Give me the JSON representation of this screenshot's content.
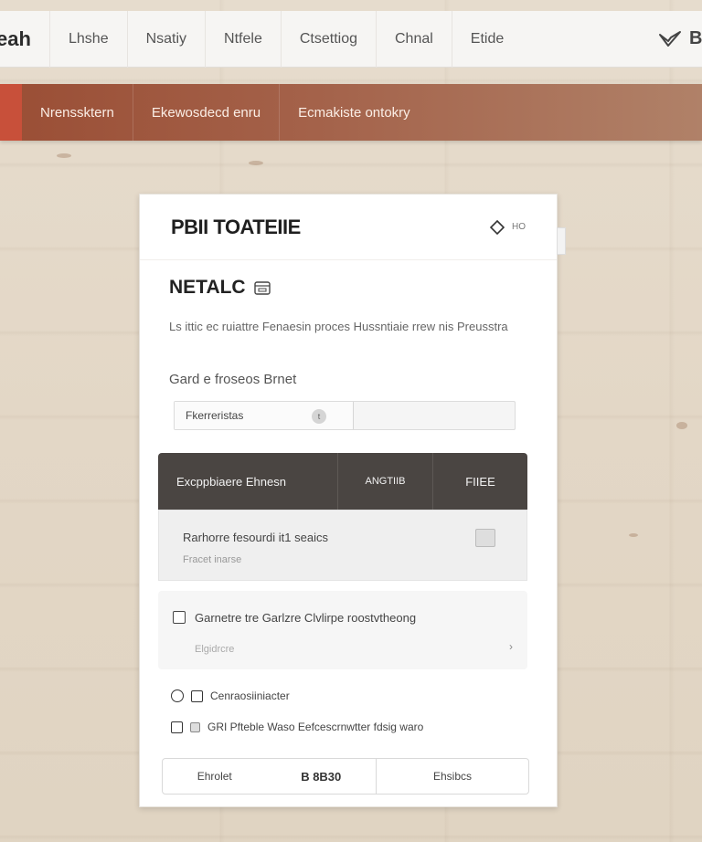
{
  "topnav": {
    "brand": "eah",
    "tabs": [
      "Lhshe",
      "Nsatiy",
      "Ntfele",
      "Ctsettiog",
      "Chnal",
      "Etide"
    ],
    "right_logo_text": "Bl"
  },
  "subnav": {
    "items": [
      "Nrenssktern",
      "Ekewosdecd enru",
      "Ecmakiste ontokry"
    ]
  },
  "card": {
    "header_title": "PBII TOATEIIE",
    "header_tool": "HO",
    "section_title": "NETALC",
    "description": "Ls ittic ec ruiattre Fenaesin proces Hussntiaie rrew nis Preusstra",
    "field_label": "Gard e froseos Brnet",
    "combo_value": "Fkerreristas",
    "combo_badge": "t",
    "table": {
      "col1": "Excppbiaere Ehnesn",
      "col2": "ANGTIIB",
      "col3": "FIIEE"
    },
    "row1": {
      "title": "Rarhorre fesourdi it1 seaics",
      "subtitle": "Fracet inarse"
    },
    "row2": {
      "title": "Garnetre tre Garlzre Clvlirpe roostvtheong",
      "subtitle": "Elgidrcre"
    },
    "option1": "Cenraosiiniacter",
    "option2": "GRI Pfteble Waso Eefcescrnwtter fdsig waro",
    "footer": {
      "left_label": "Ehrolet",
      "left_value": "B 8B30",
      "right_label": "Ehsibcs"
    }
  }
}
